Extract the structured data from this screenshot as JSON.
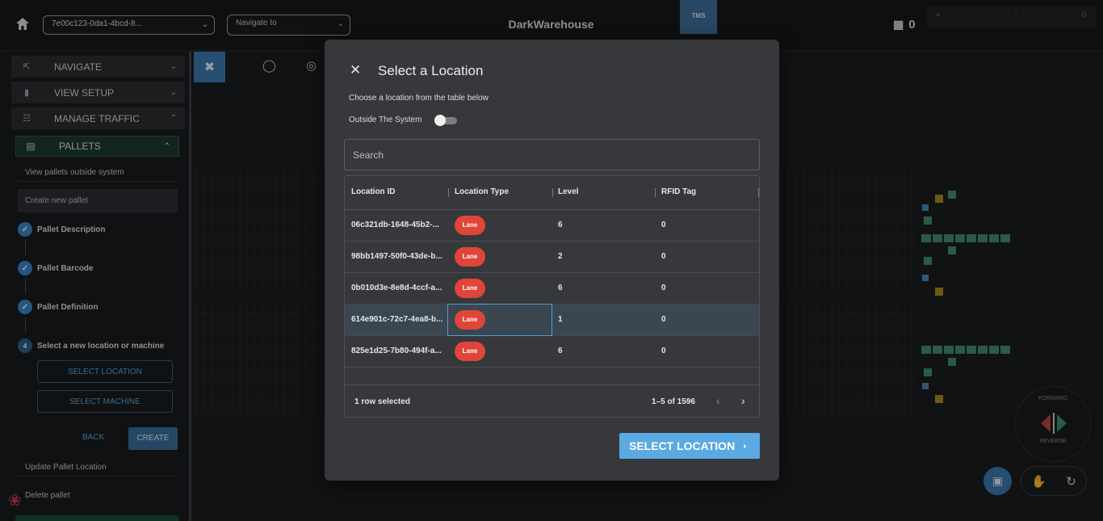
{
  "topbar": {
    "warehouse_select": "7e00c123-0da1-4bcd-8...",
    "navigate_placeholder": "Navigate to",
    "app_title": "DarkWarehouse",
    "tms_tab": "TMS",
    "counter_value": "0"
  },
  "sidebar": {
    "sections": [
      {
        "label": "NAVIGATE",
        "icon": "expand-icon"
      },
      {
        "label": "VIEW SETUP",
        "icon": "camera-icon"
      },
      {
        "label": "MANAGE TRAFFIC",
        "icon": "network-icon"
      }
    ],
    "pallets_label": "PALLETS",
    "view_outside": "View pallets outside system",
    "create_new": "Create new pallet",
    "steps": [
      {
        "label": "Pallet Description",
        "done": true
      },
      {
        "label": "Pallet Barcode",
        "done": true
      },
      {
        "label": "Pallet Definition",
        "done": true
      },
      {
        "label": "Select a new location or machine",
        "number": "4"
      }
    ],
    "select_location_btn": "SELECT LOCATION",
    "select_machine_btn": "SELECT MACHINE",
    "back_btn": "BACK",
    "create_btn": "CREATE",
    "update_location": "Update Pallet Location",
    "delete_pallet": "Delete pallet"
  },
  "compass": {
    "top": "FORWARD",
    "bottom": "REVERSE"
  },
  "dialog": {
    "title": "Select a Location",
    "subtitle": "Choose a location from the table below",
    "toggle_label": "Outside The System",
    "toggle_on": false,
    "search_placeholder": "Search",
    "columns": [
      "Location ID",
      "Location Type",
      "Level",
      "RFID Tag"
    ],
    "rows": [
      {
        "id": "06c321db-1648-45b2-...",
        "type": "Lane",
        "level": "6",
        "rfid": "0"
      },
      {
        "id": "98bb1497-50f0-43de-b...",
        "type": "Lane",
        "level": "2",
        "rfid": "0"
      },
      {
        "id": "0b010d3e-8e8d-4ccf-a...",
        "type": "Lane",
        "level": "6",
        "rfid": "0"
      },
      {
        "id": "614e901c-72c7-4ea8-b...",
        "type": "Lane",
        "level": "1",
        "rfid": "0",
        "selected": true
      },
      {
        "id": "825e1d25-7b80-494f-a...",
        "type": "Lane",
        "level": "6",
        "rfid": "0"
      }
    ],
    "selected_text": "1 row selected",
    "pagination": "1–5 of 1596",
    "confirm_btn": "SELECT LOCATION",
    "badge_color": "#e0453a",
    "accent": "#5aa9e3"
  }
}
